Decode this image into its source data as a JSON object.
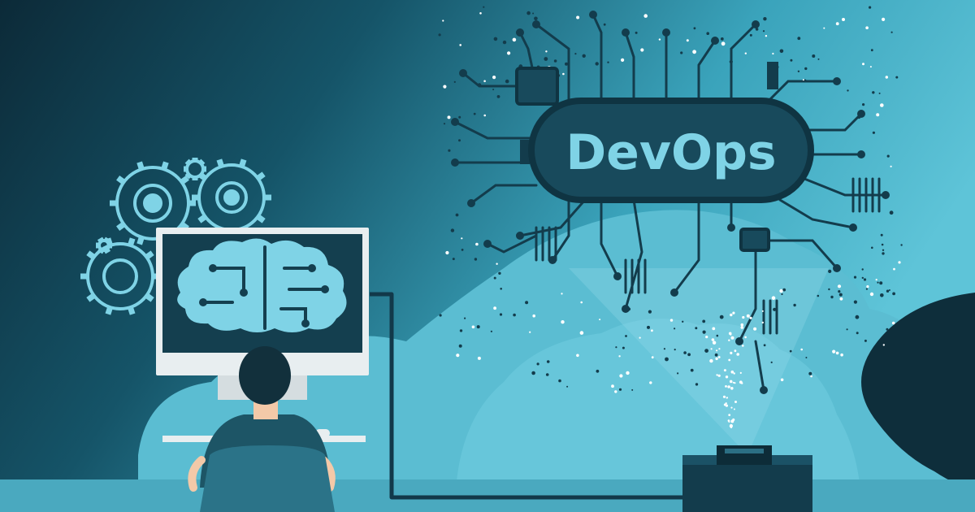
{
  "illustration": {
    "badge_text": "DevOps"
  },
  "colors": {
    "bg_dark": "#0e2f3d",
    "bg_mid": "#1e6b80",
    "bg_light": "#5ec4d8",
    "circuit": "#133c4c",
    "accent": "#7fd3e6",
    "accent_light": "#9fdfee",
    "badge_fill": "#184a5c",
    "screen": "#143f4f",
    "monitor_frame": "#e8eef0",
    "shirt": "#1d5566",
    "hair": "#12303c",
    "skin": "#f3c9a8"
  }
}
